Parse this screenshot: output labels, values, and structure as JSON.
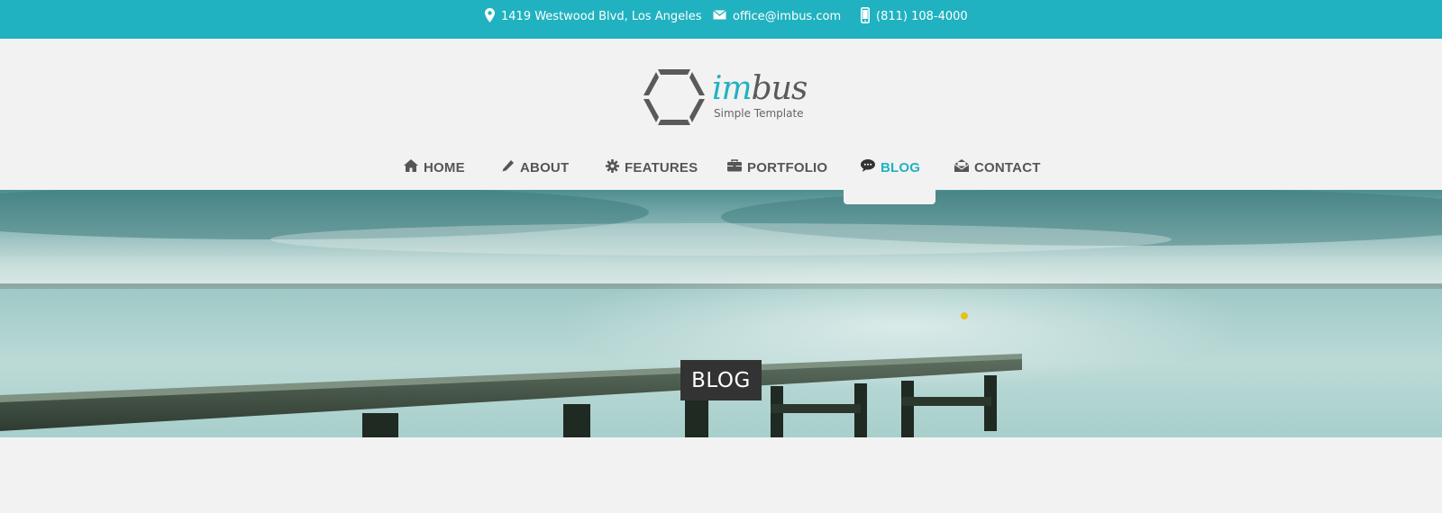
{
  "topbar": {
    "address": "1419 Westwood Blvd, Los Angeles",
    "email": "office@imbus.com",
    "phone": "(811) 108-4000",
    "icons": [
      "map-pin-icon",
      "envelope-icon",
      "mobile-phone-icon"
    ]
  },
  "logo": {
    "name_accent": "im",
    "name_rest": "bus",
    "tagline": "Simple Template"
  },
  "nav": {
    "items": [
      {
        "label": "HOME",
        "icon": "home-icon"
      },
      {
        "label": "ABOUT",
        "icon": "pencil-icon"
      },
      {
        "label": "FEATURES",
        "icon": "gear-icon"
      },
      {
        "label": "PORTFOLIO",
        "icon": "briefcase-icon"
      },
      {
        "label": "BLOG",
        "icon": "speech-bubble-icon",
        "active": true
      },
      {
        "label": "CONTACT",
        "icon": "envelope-open-icon"
      }
    ]
  },
  "hero": {
    "title": "BLOG"
  },
  "colors": {
    "accent": "#20b2c0",
    "nav_text": "#555555",
    "background": "#f2f2f2",
    "title_box": "#333333"
  }
}
